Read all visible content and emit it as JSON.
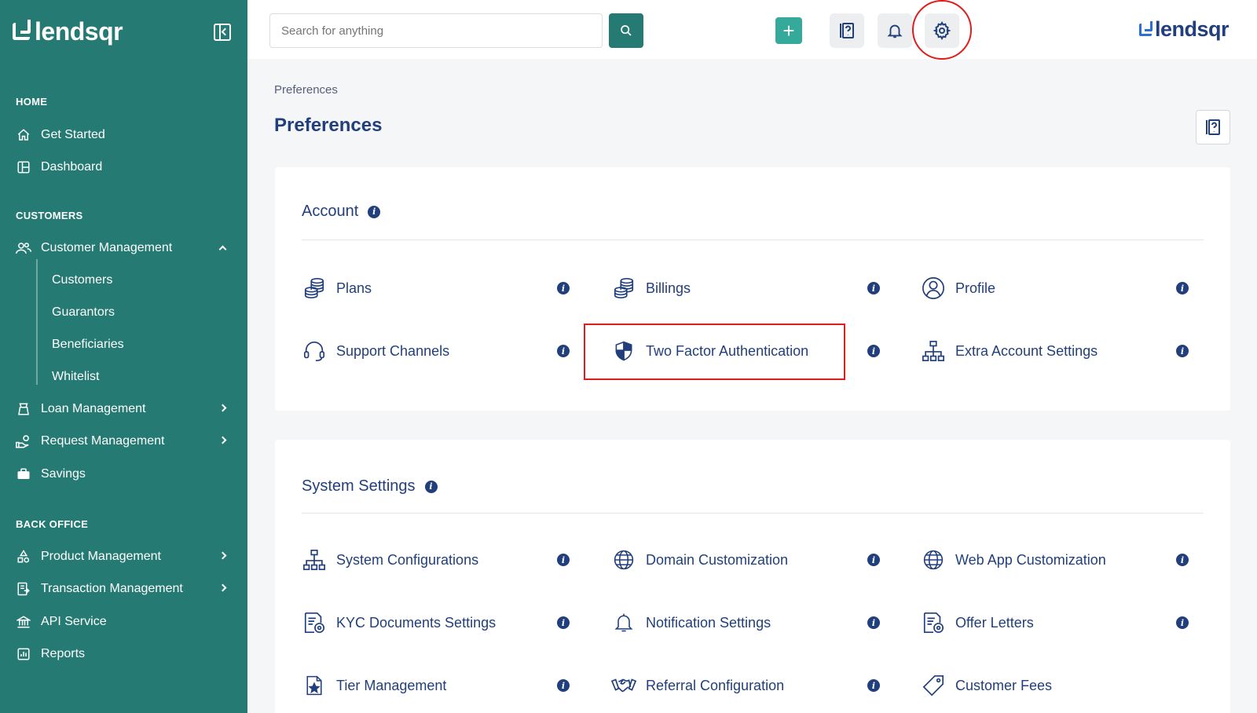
{
  "sidebar": {
    "logo_text": "lendsqr",
    "sections": {
      "home": "HOME",
      "customers": "CUSTOMERS",
      "back_office": "BACK OFFICE"
    },
    "items": {
      "get_started": "Get Started",
      "dashboard": "Dashboard",
      "customer_management": "Customer Management",
      "loan_management": "Loan Management",
      "request_management": "Request Management",
      "savings": "Savings",
      "product_management": "Product Management",
      "transaction_management": "Transaction Management",
      "api_service": "API Service",
      "reports": "Reports"
    },
    "customer_sub": [
      "Customers",
      "Guarantors",
      "Beneficiaries",
      "Whitelist"
    ]
  },
  "topbar": {
    "search_placeholder": "Search for anything",
    "add_label": "+",
    "logo_text": "lendsqr"
  },
  "main": {
    "breadcrumb": "Preferences",
    "title": "Preferences"
  },
  "account": {
    "title": "Account",
    "options": {
      "plans": "Plans",
      "billings": "Billings",
      "profile": "Profile",
      "support_channels": "Support Channels",
      "two_factor": "Two Factor Authentication",
      "extra_account": "Extra Account Settings"
    }
  },
  "system": {
    "title": "System Settings",
    "options": {
      "system_configurations": "System Configurations",
      "domain_customization": "Domain Customization",
      "web_app_customization": "Web App Customization",
      "kyc_documents": "KYC Documents Settings",
      "notification_settings": "Notification Settings",
      "offer_letters": "Offer Letters",
      "tier_management": "Tier Management",
      "referral_configuration": "Referral Configuration",
      "customer_fees": "Customer Fees"
    }
  },
  "colors": {
    "sidebar": "#257a74",
    "primary_text": "#213f7d",
    "accent": "#35aa9a",
    "highlight": "#e21b1b"
  },
  "info_glyph": "i"
}
